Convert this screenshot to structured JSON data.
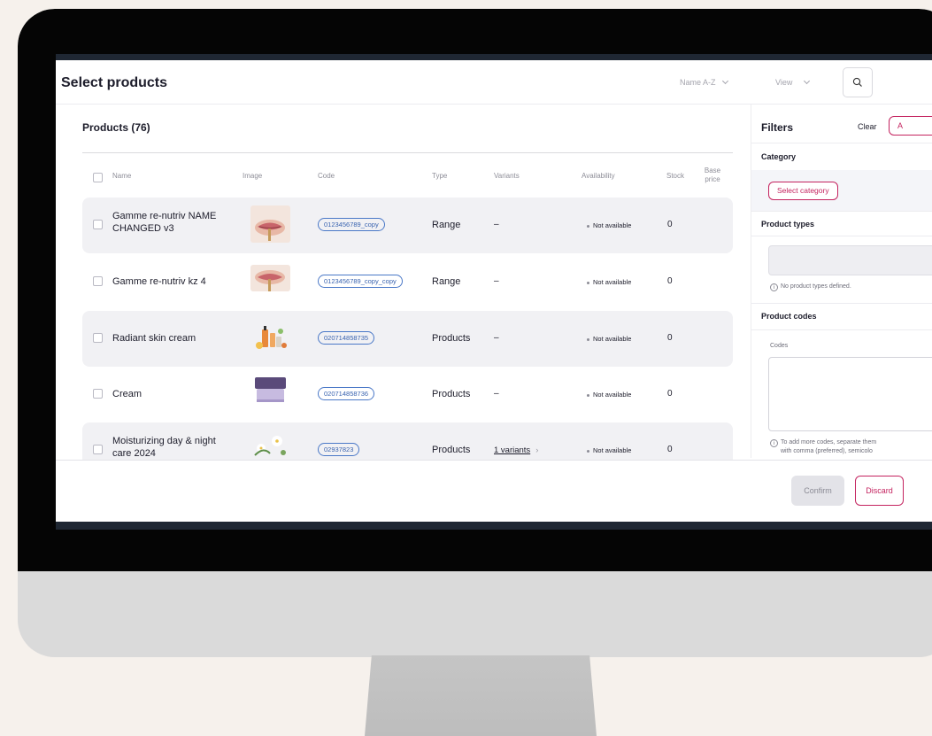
{
  "header": {
    "title": "Select products",
    "sort_value": "Name A-Z",
    "view_value": "View"
  },
  "products": {
    "title": "Products (76)",
    "columns": {
      "name": "Name",
      "image": "Image",
      "code": "Code",
      "type": "Type",
      "variants": "Variants",
      "availability": "Availability",
      "stock": "Stock",
      "base_price": "Base price"
    },
    "rows": [
      {
        "name": "Gamme re-nutriv NAME CHANGED v3",
        "image": "lips-icon",
        "code": "0123456789_copy",
        "type": "Range",
        "variants": "–",
        "availability": "Not available",
        "stock": "0"
      },
      {
        "name": "Gamme re-nutriv kz 4",
        "image": "lips-icon",
        "code": "0123456789_copy_copy",
        "type": "Range",
        "variants": "–",
        "availability": "Not available",
        "stock": "0"
      },
      {
        "name": "Radiant skin cream",
        "image": "bottles-icon",
        "code": "020714858735",
        "type": "Products",
        "variants": "–",
        "availability": "Not available",
        "stock": "0"
      },
      {
        "name": "Cream",
        "image": "jar-icon",
        "code": "020714858736",
        "type": "Products",
        "variants": "–",
        "availability": "Not available",
        "stock": "0"
      },
      {
        "name": "Moisturizing day & night care 2024",
        "image": "flowers-icon",
        "code": "02937823",
        "type": "Products",
        "variants": "1 variants",
        "availability": "Not available",
        "stock": "0"
      }
    ]
  },
  "filters": {
    "title": "Filters",
    "clear_label": "Clear",
    "apply_label": "A",
    "category": {
      "label": "Category",
      "button": "Select category"
    },
    "product_types": {
      "label": "Product types",
      "hint": "No product types defined."
    },
    "product_codes": {
      "label": "Product codes",
      "codes_label": "Codes",
      "hint_line1": "To add more codes, separate them",
      "hint_line2": "with comma (preferred), semicolo"
    }
  },
  "footer": {
    "confirm_label": "Confirm",
    "discard_label": "Discard"
  },
  "colors": {
    "accent": "#c4235f",
    "code_pill": "#3a64b0",
    "row_shade": "#f1f1f4",
    "background": "#f6f1ec"
  }
}
